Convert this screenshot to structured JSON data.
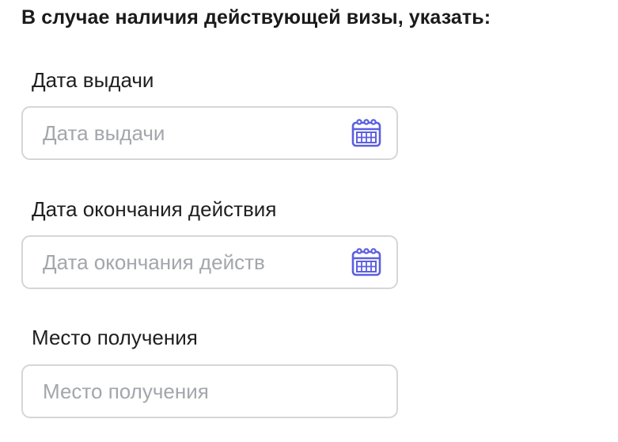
{
  "section": {
    "title": "В случае наличия действующей визы, указать:"
  },
  "fields": {
    "issue_date": {
      "label": "Дата выдачи",
      "placeholder": "Дата выдачи",
      "icon": "calendar-icon"
    },
    "expiry_date": {
      "label": "Дата окончания действия",
      "placeholder": "Дата окончания действ",
      "icon": "calendar-icon"
    },
    "place_of_issue": {
      "label": "Место получения",
      "placeholder": "Место получения"
    }
  },
  "colors": {
    "icon_accent": "#5b5fe0",
    "input_border": "#d6d6d6",
    "placeholder": "#a3a6ab"
  }
}
